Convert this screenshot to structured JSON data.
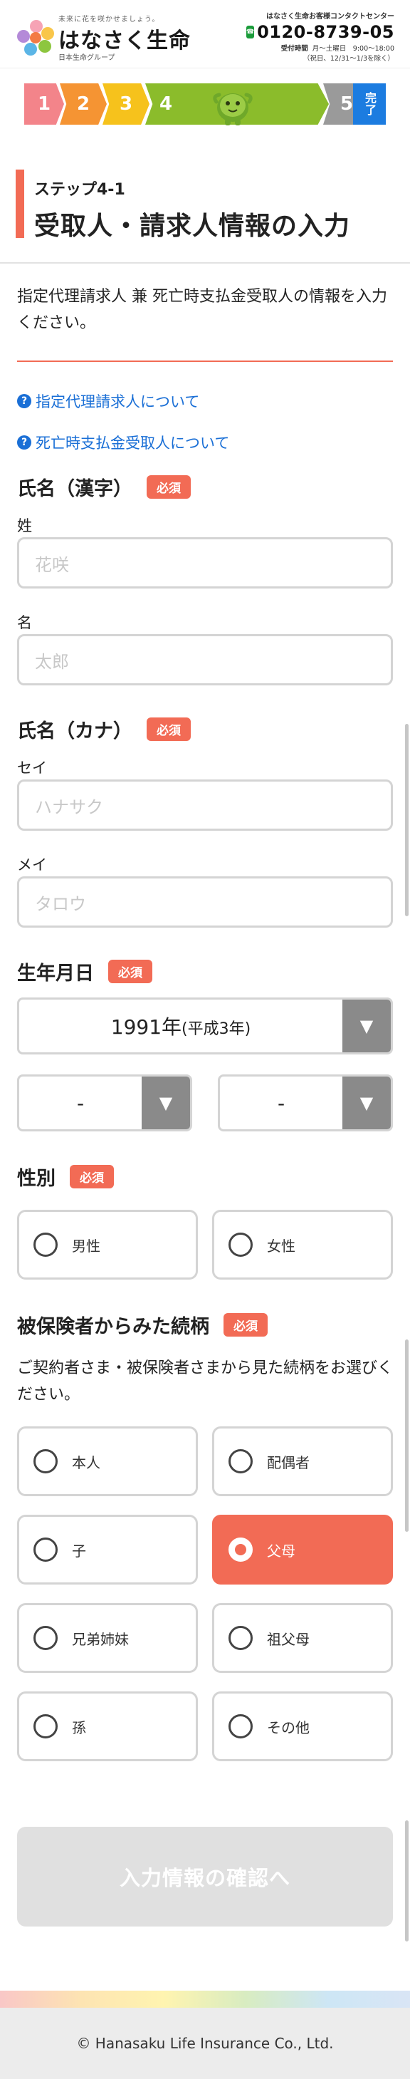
{
  "header": {
    "tagline": "未来に花を咲かせましょう。",
    "logo_name": "はなさく生命",
    "logo_sub": "日本生命グループ",
    "contact_title": "はなさく生命お客様コンタクトセンター",
    "freedial_icon": "freedial-icon",
    "phone": "0120-8739-05",
    "hours_label": "受付時間",
    "hours": "月〜土曜日　9:00〜18:00",
    "hours_note": "（祝日、12/31〜1/3を除く）"
  },
  "steps": {
    "items": [
      "1",
      "2",
      "3",
      "4",
      "5"
    ],
    "done_label": "完了",
    "current": "4",
    "mascot_icon": "mascot-icon"
  },
  "title": {
    "step": "ステップ4-1",
    "main": "受取人・請求人情報の入力"
  },
  "intro": "指定代理請求人 兼 死亡時支払金受取人の情報を入力ください。",
  "help_links": [
    "指定代理請求人について",
    "死亡時支払金受取人について"
  ],
  "required_label": "必須",
  "name_kanji": {
    "label": "氏名（漢字）",
    "sei_label": "姓",
    "sei_placeholder": "花咲",
    "mei_label": "名",
    "mei_placeholder": "太郎"
  },
  "name_kana": {
    "label": "氏名（カナ）",
    "sei_label": "セイ",
    "sei_placeholder": "ハナサク",
    "mei_label": "メイ",
    "mei_placeholder": "タロウ"
  },
  "birthdate": {
    "label": "生年月日",
    "year": "1991年",
    "year_era": "(平成3年)",
    "month": "-",
    "day": "-"
  },
  "gender": {
    "label": "性別",
    "options": [
      "男性",
      "女性"
    ]
  },
  "relationship": {
    "label": "被保険者からみた続柄",
    "description": "ご契約者さま・被保険者さまから見た続柄をお選びください。",
    "options": [
      "本人",
      "配偶者",
      "子",
      "父母",
      "兄弟姉妹",
      "祖父母",
      "孫",
      "その他"
    ],
    "selected": "父母"
  },
  "submit_label": "入力情報の確認へ",
  "footer": "© Hanasaku Life Insurance Co., Ltd.",
  "colors": {
    "accent": "#f26b55",
    "link": "#1a6fd6",
    "step_current": "#8bbc2b"
  }
}
